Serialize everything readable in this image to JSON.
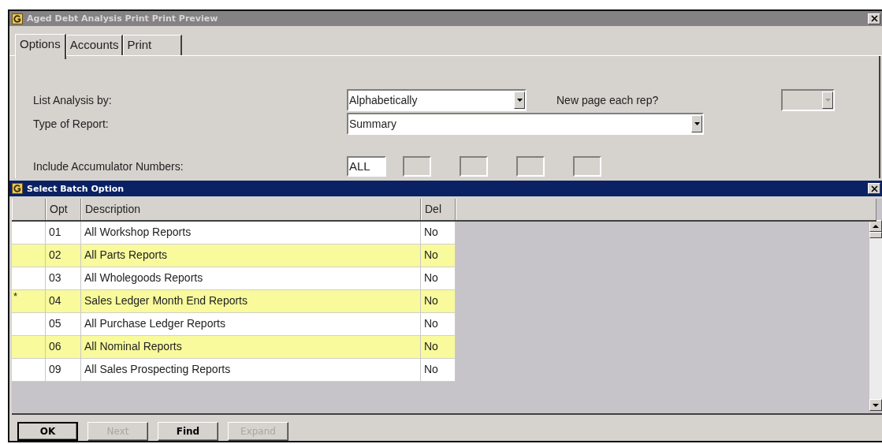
{
  "window": {
    "title": "Aged Debt Analysis Print Print Preview",
    "active": false
  },
  "tabs": [
    {
      "label": "Options",
      "selected": true
    },
    {
      "label": "Accounts",
      "selected": false
    },
    {
      "label": "Print",
      "selected": false
    }
  ],
  "options": {
    "list_analysis": {
      "label": "List Analysis by:",
      "value": "Alphabetically"
    },
    "new_page": {
      "label": "New page each rep?",
      "disabled": true
    },
    "report_type": {
      "label": "Type of Report:",
      "value": "Summary"
    },
    "accumulators": {
      "label": "Include Accumulator Numbers:",
      "fields": [
        {
          "value": "ALL",
          "disabled": false
        },
        {
          "disabled": true
        },
        {
          "disabled": true
        },
        {
          "disabled": true
        },
        {
          "disabled": true
        }
      ]
    }
  },
  "dialog": {
    "title": "Select Batch Option",
    "active": true,
    "columns": [
      "Opt",
      "Description",
      "Del"
    ],
    "rows": [
      {
        "marker": "",
        "opt": "01",
        "description": "All Workshop Reports",
        "del": "No"
      },
      {
        "marker": "",
        "opt": "02",
        "description": "All Parts Reports",
        "del": "No"
      },
      {
        "marker": "",
        "opt": "03",
        "description": "All Wholegoods Reports",
        "del": "No"
      },
      {
        "marker": "*",
        "opt": "04",
        "description": "Sales Ledger Month End Reports",
        "del": "No"
      },
      {
        "marker": "",
        "opt": "05",
        "description": "All Purchase Ledger Reports",
        "del": "No"
      },
      {
        "marker": "",
        "opt": "06",
        "description": "All Nominal Reports",
        "del": "No"
      },
      {
        "marker": "",
        "opt": "09",
        "description": "All Sales Prospecting Reports",
        "del": "No"
      }
    ],
    "buttons": [
      {
        "label": "OK",
        "disabled": false
      },
      {
        "label": "Next",
        "disabled": true
      },
      {
        "label": "Find",
        "disabled": false
      },
      {
        "label": "Expand",
        "disabled": true
      }
    ]
  }
}
